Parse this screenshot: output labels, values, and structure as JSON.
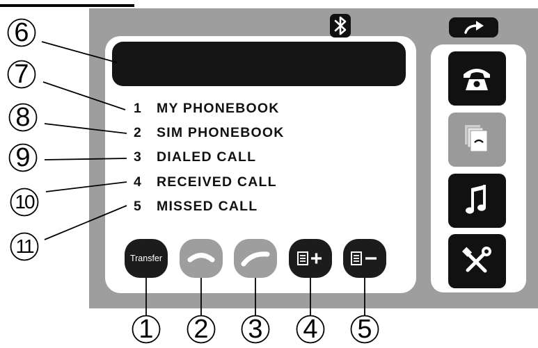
{
  "menu": {
    "items": [
      {
        "number": "1",
        "label": "MY PHONEBOOK"
      },
      {
        "number": "2",
        "label": "SIM PHONEBOOK"
      },
      {
        "number": "3",
        "label": "DIALED CALL"
      },
      {
        "number": "4",
        "label": "RECEIVED CALL"
      },
      {
        "number": "5",
        "label": "MISSED CALL"
      }
    ]
  },
  "bottom_bar": {
    "transfer_label": "Transfer"
  },
  "side_menu": {
    "icons": [
      "phone-handset-icon",
      "phonebook-cards-icon",
      "music-note-icon",
      "settings-tools-icon"
    ]
  },
  "status": {
    "bluetooth_icon": "bluetooth-icon",
    "back_icon": "back-arrow-icon"
  },
  "callouts": {
    "left": [
      "6",
      "7",
      "8",
      "9",
      "10",
      "11"
    ],
    "bottom": [
      "1",
      "2",
      "3",
      "4",
      "5"
    ]
  },
  "colors": {
    "device_frame": "#9e9e9e",
    "screen": "#ffffff",
    "button_dark": "#111111",
    "button_dim": "#9a9a9a"
  }
}
